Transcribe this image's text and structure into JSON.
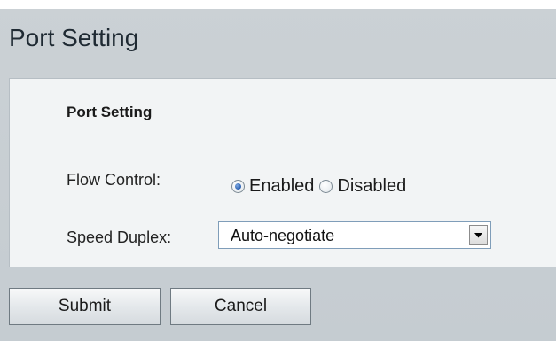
{
  "header": {
    "title": "Port Setting"
  },
  "form": {
    "section_title": "Port Setting",
    "flow_control": {
      "label": "Flow Control:",
      "options": [
        {
          "label": "Enabled",
          "checked": true
        },
        {
          "label": "Disabled",
          "checked": false
        }
      ]
    },
    "speed_duplex": {
      "label": "Speed Duplex:",
      "selected": "Auto-negotiate"
    }
  },
  "buttons": {
    "submit_label": "Submit",
    "cancel_label": "Cancel"
  },
  "icons": {
    "dropdown": "chevron-down-icon",
    "radio_selected": "radio-selected-icon",
    "radio_unselected": "radio-unselected-icon"
  },
  "colors": {
    "page_background": "#c7ced3",
    "panel_background": "#f2f4f5",
    "radio_selected": "#2a5fb0",
    "select_border": "#7f9db9"
  }
}
